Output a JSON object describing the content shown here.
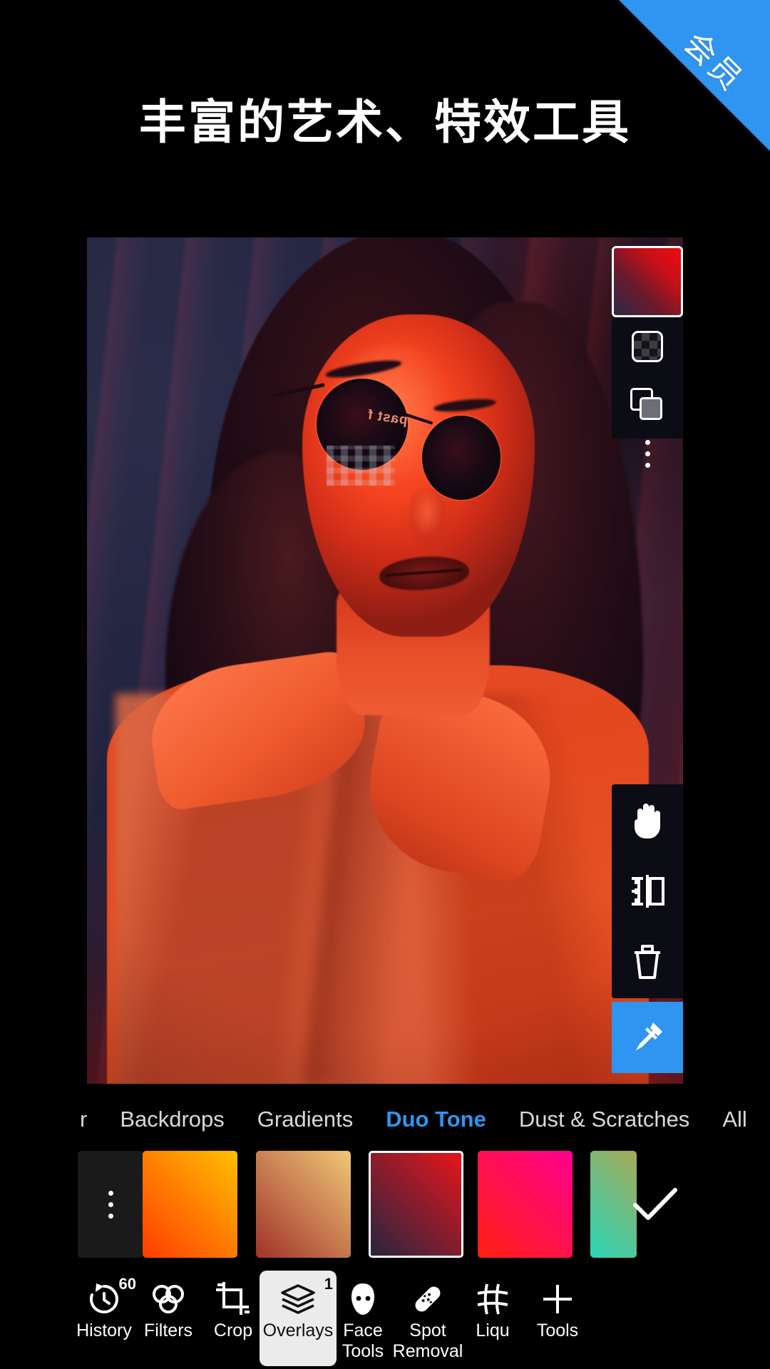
{
  "promo": {
    "ribbon_label": "会员",
    "ribbon_color": "#2f95f0"
  },
  "headline": "丰富的艺术、特效工具",
  "canvas": {
    "lens_reflection_text": "past f",
    "duotone_highlight": "#f3421f",
    "duotone_shadow": "#22243c"
  },
  "layer_panel": {
    "thumbnail_name": "duo-tone-gradient-thumbnail",
    "thumbnail_gradient_from": "#f00c10",
    "thumbnail_gradient_to": "#2b2a46",
    "buttons": [
      {
        "name": "mask-transparency-icon"
      },
      {
        "name": "blend-mode-icon"
      },
      {
        "name": "more-options-icon"
      }
    ]
  },
  "tool_rail": {
    "buttons": [
      {
        "name": "pan-hand-tool"
      },
      {
        "name": "flip-mirror-tool"
      },
      {
        "name": "delete-layer-tool"
      }
    ],
    "eyedropper": {
      "name": "eyedropper-tool",
      "active": true,
      "accent": "#2f95f0"
    }
  },
  "tabs": {
    "items": [
      {
        "label": "r",
        "active": false,
        "truncated": true
      },
      {
        "label": "Backdrops",
        "active": false
      },
      {
        "label": "Gradients",
        "active": false
      },
      {
        "label": "Duo Tone",
        "active": true
      },
      {
        "label": "Dust & Scratches",
        "active": false
      },
      {
        "label": "All",
        "active": false
      }
    ],
    "active_color": "#2f95f0"
  },
  "swatches": {
    "items": [
      {
        "name": "more-swatches",
        "type": "dots",
        "color": "#1a1a1a",
        "selected": false
      },
      {
        "name": "swatch-orange",
        "from": "#ffc000",
        "to": "#ff3c00",
        "selected": false
      },
      {
        "name": "swatch-tan",
        "from": "#f0c878",
        "to": "#a03228",
        "selected": false
      },
      {
        "name": "swatch-crimson-navy",
        "from": "#e8141c",
        "to": "#26263e",
        "selected": true
      },
      {
        "name": "swatch-magenta-red",
        "from": "#ff0090",
        "to": "#ff2010",
        "selected": false
      },
      {
        "name": "swatch-olive-teal",
        "from": "#a8a858",
        "to": "#2ad6b8",
        "selected": false
      }
    ],
    "confirm_label": "✓"
  },
  "bottombar": {
    "items": [
      {
        "label": "History",
        "icon": "history-icon",
        "badge": "60",
        "active": false
      },
      {
        "label": "Filters",
        "icon": "filters-icon",
        "badge": "",
        "active": false
      },
      {
        "label": "Crop",
        "icon": "crop-icon",
        "badge": "",
        "active": false
      },
      {
        "label": "Overlays",
        "icon": "overlays-icon",
        "badge": "1",
        "active": true
      },
      {
        "label": "Face\nTools",
        "icon": "face-tools-icon",
        "badge": "",
        "active": false
      },
      {
        "label": "Spot\nRemoval",
        "icon": "spot-removal-icon",
        "badge": "",
        "active": false
      },
      {
        "label": "Liqu",
        "icon": "liquify-icon",
        "badge": "",
        "active": false
      },
      {
        "label": "Tools",
        "icon": "tools-plus-icon",
        "badge": "",
        "active": false
      }
    ]
  }
}
